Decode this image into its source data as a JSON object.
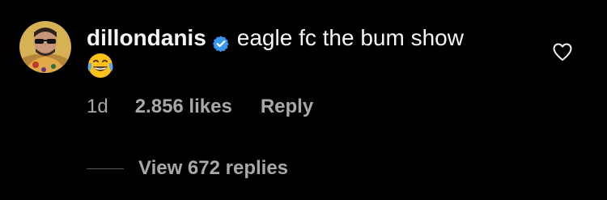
{
  "comment": {
    "username": "dillondanis",
    "verified": true,
    "text": "eagle fc the bum show",
    "emoji": "😂",
    "time": "1d",
    "likes": "2.856 likes",
    "reply_label": "Reply"
  },
  "replies": {
    "view_label": "View 672 replies"
  },
  "colors": {
    "background": "#000000",
    "text_primary": "#f5f5f5",
    "text_secondary": "#a8a8a8",
    "verified_badge": "#3797f0"
  },
  "icons": {
    "verified": "verified-badge-icon",
    "like": "heart-outline-icon",
    "emoji": "face-with-tears-of-joy"
  }
}
